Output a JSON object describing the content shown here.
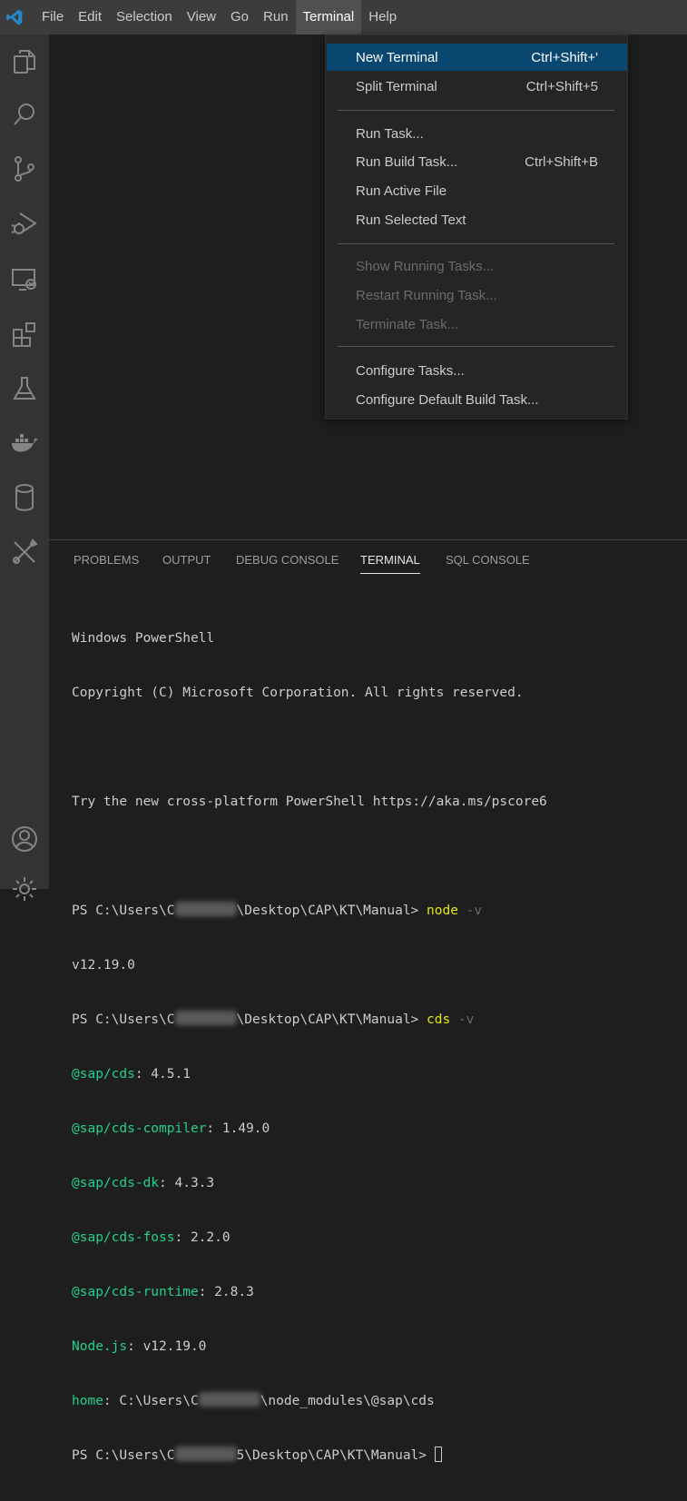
{
  "menubar": {
    "items": [
      "File",
      "Edit",
      "Selection",
      "View",
      "Go",
      "Run",
      "Terminal",
      "Help"
    ],
    "active": "Terminal"
  },
  "terminal_menu": {
    "items": [
      {
        "label": "New Terminal",
        "shortcut": "Ctrl+Shift+'",
        "state": "highlighted"
      },
      {
        "label": "Split Terminal",
        "shortcut": "Ctrl+Shift+5",
        "state": "normal"
      },
      {
        "label": "Run Task...",
        "shortcut": "",
        "state": "normal"
      },
      {
        "label": "Run Build Task...",
        "shortcut": "Ctrl+Shift+B",
        "state": "normal"
      },
      {
        "label": "Run Active File",
        "shortcut": "",
        "state": "normal"
      },
      {
        "label": "Run Selected Text",
        "shortcut": "",
        "state": "normal"
      },
      {
        "label": "Show Running Tasks...",
        "shortcut": "",
        "state": "disabled"
      },
      {
        "label": "Restart Running Task...",
        "shortcut": "",
        "state": "disabled"
      },
      {
        "label": "Terminate Task...",
        "shortcut": "",
        "state": "disabled"
      },
      {
        "label": "Configure Tasks...",
        "shortcut": "",
        "state": "normal"
      },
      {
        "label": "Configure Default Build Task...",
        "shortcut": "",
        "state": "normal"
      }
    ]
  },
  "activity_icons": [
    "explorer-icon",
    "search-icon",
    "source-control-icon",
    "run-debug-icon",
    "remote-explorer-icon",
    "extensions-icon",
    "testing-icon",
    "docker-icon",
    "database-icon",
    "tools-icon",
    "account-icon",
    "settings-icon"
  ],
  "panel": {
    "tabs": [
      "PROBLEMS",
      "OUTPUT",
      "DEBUG CONSOLE",
      "TERMINAL",
      "SQL CONSOLE"
    ],
    "active_tab": "TERMINAL"
  },
  "terminal": {
    "line1": "Windows PowerShell",
    "line2": "Copyright (C) Microsoft Corporation. All rights reserved.",
    "line3": "Try the new cross-platform PowerShell https://aka.ms/pscore6",
    "prompt_prefix": "PS C:\\Users\\C",
    "prompt_suffix": "\\Desktop\\CAP\\KT\\Manual> ",
    "cmd1": "node",
    "cmd1_flag": " -v",
    "node_version": "v12.19.0",
    "cmd2": "cds",
    "cmd2_flag": " -v",
    "cds_output": [
      {
        "key": "@sap/cds",
        "value": ": 4.5.1"
      },
      {
        "key": "@sap/cds-compiler",
        "value": ": 1.49.0"
      },
      {
        "key": "@sap/cds-dk",
        "value": ": 4.3.3"
      },
      {
        "key": "@sap/cds-foss",
        "value": ": 2.2.0"
      },
      {
        "key": "@sap/cds-runtime",
        "value": ": 2.8.3"
      },
      {
        "key": "Node.js",
        "value": ": v12.19.0"
      }
    ],
    "home_key": "home",
    "home_prefix": ": C:\\Users\\C",
    "home_suffix": "\\node_modules\\@sap\\cds",
    "last_prompt_prefix": "PS C:\\Users\\C",
    "last_prompt_suffix": "5\\Desktop\\CAP\\KT\\Manual> "
  },
  "colors": {
    "accent": "#094771",
    "prompt_cmd": "#e5e510",
    "cds_key": "#23d18b"
  }
}
